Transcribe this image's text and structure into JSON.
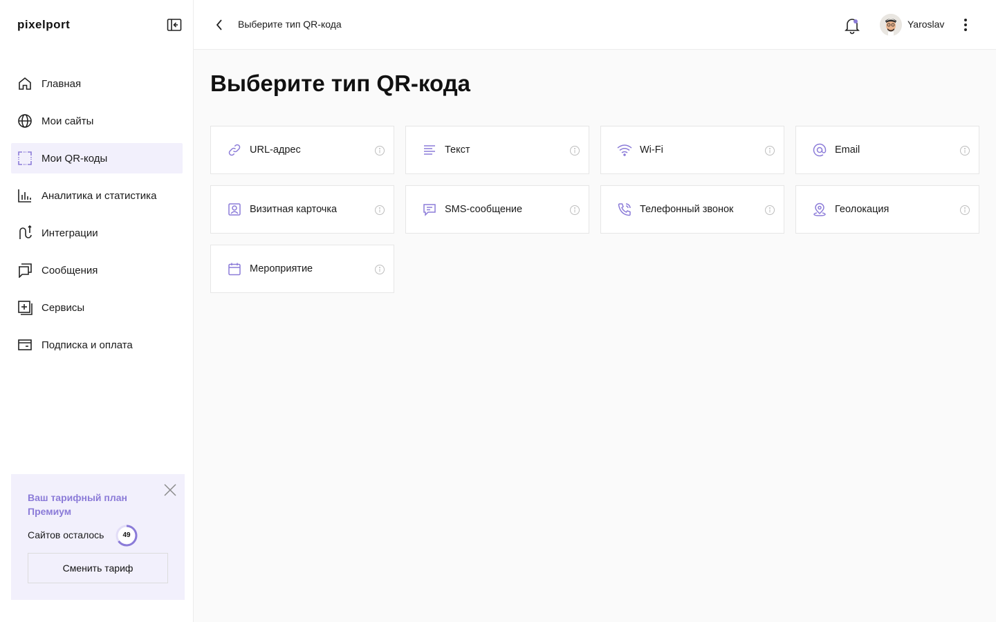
{
  "app": {
    "logo_text": "pixelport",
    "accent_color": "#8b7bd8"
  },
  "sidebar": {
    "items": [
      {
        "label": "Главная",
        "icon": "home-icon",
        "active": false
      },
      {
        "label": "Мои сайты",
        "icon": "globe-icon",
        "active": false
      },
      {
        "label": "Мои QR-коды",
        "icon": "qr-scan-icon",
        "active": true
      },
      {
        "label": "Аналитика и статистика",
        "icon": "analytics-icon",
        "active": false
      },
      {
        "label": "Интеграции",
        "icon": "integrations-icon",
        "active": false
      },
      {
        "label": "Сообщения",
        "icon": "messages-icon",
        "active": false
      },
      {
        "label": "Сервисы",
        "icon": "services-icon",
        "active": false
      },
      {
        "label": "Подписка и оплата",
        "icon": "wallet-icon",
        "active": false
      }
    ]
  },
  "plan": {
    "title": "Ваш тарифный план Премиум",
    "sites_label": "Сайтов осталось",
    "sites_remaining": "49",
    "change_button": "Сменить тариф"
  },
  "header": {
    "title": "Выберите тип QR-кода",
    "username": "Yaroslav"
  },
  "main": {
    "title": "Выберите тип QR-кода",
    "types": [
      {
        "label": "URL-адрес",
        "icon": "link-icon"
      },
      {
        "label": "Текст",
        "icon": "text-lines-icon"
      },
      {
        "label": "Wi-Fi",
        "icon": "wifi-icon"
      },
      {
        "label": "Email",
        "icon": "at-sign-icon"
      },
      {
        "label": "Визитная карточка",
        "icon": "contact-card-icon"
      },
      {
        "label": "SMS-сообщение",
        "icon": "sms-icon"
      },
      {
        "label": "Телефонный звонок",
        "icon": "phone-icon"
      },
      {
        "label": "Геолокация",
        "icon": "location-pin-icon"
      },
      {
        "label": "Мероприятие",
        "icon": "calendar-icon"
      }
    ]
  }
}
